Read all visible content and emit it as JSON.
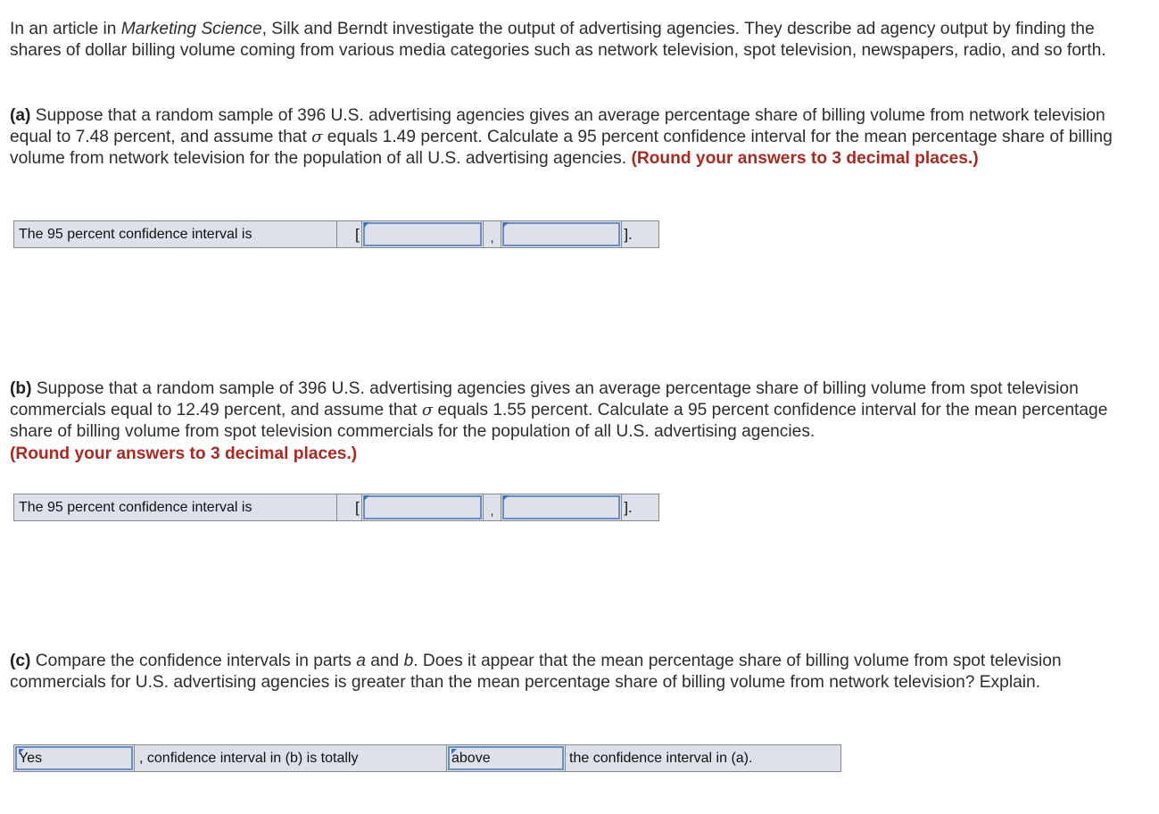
{
  "intro": {
    "text_before": "In an article in ",
    "journal": "Marketing Science",
    "text_after": ", Silk and Berndt investigate the output of advertising agencies. They describe ad agency output by finding the shares of dollar billing volume coming from various media categories such as network television, spot television, newspapers, radio, and so forth."
  },
  "part_a": {
    "label": "(a)",
    "text_1": " Suppose that a random sample of 396 U.S. advertising agencies gives an average percentage share of billing volume from network television equal to 7.48 percent, and assume that ",
    "sigma": "σ",
    "text_2": " equals 1.49 percent. Calculate a 95 percent confidence interval for the mean percentage share of billing volume from network television for the population of all U.S. advertising agencies. ",
    "instruction": "(Round your answers to 3 decimal places.)",
    "answer_row": {
      "label": "The 95 percent confidence interval is",
      "open_bracket": "[",
      "separator": ",",
      "close_bracket": "].",
      "lower_value": "",
      "upper_value": ""
    }
  },
  "part_b": {
    "label": "(b)",
    "text_1": " Suppose that a random sample of 396 U.S. advertising agencies gives an average percentage share of billing volume from spot television commercials equal to 12.49 percent, and assume that ",
    "sigma": "σ",
    "text_2": " equals 1.55 percent. Calculate a 95 percent confidence interval for the mean percentage share of billing volume from spot television commercials for the population of all U.S. advertising agencies.",
    "instruction": "(Round your answers to 3 decimal places.)",
    "answer_row": {
      "label": "The 95 percent confidence interval is",
      "open_bracket": "[",
      "separator": ",",
      "close_bracket": "].",
      "lower_value": "",
      "upper_value": ""
    }
  },
  "part_c": {
    "label": "(c)",
    "text_1": " Compare the confidence intervals in parts ",
    "part_a_ref": "a",
    "text_2": " and ",
    "part_b_ref": "b",
    "text_3": ". Does it appear that the mean percentage share of billing volume from spot television commercials for U.S. advertising agencies is greater than the mean percentage share of billing volume from network television? Explain.",
    "answer_row": {
      "select_1_value": "Yes",
      "middle_text": ", confidence interval in (b) is totally",
      "select_2_value": "above",
      "end_text": "the confidence interval in (a)."
    }
  },
  "colors": {
    "instruction_red": "#a82a22",
    "answer_bg": "#dde1ea",
    "input_border": "#6b8fc4",
    "flag_blue": "#3b6fc2"
  }
}
